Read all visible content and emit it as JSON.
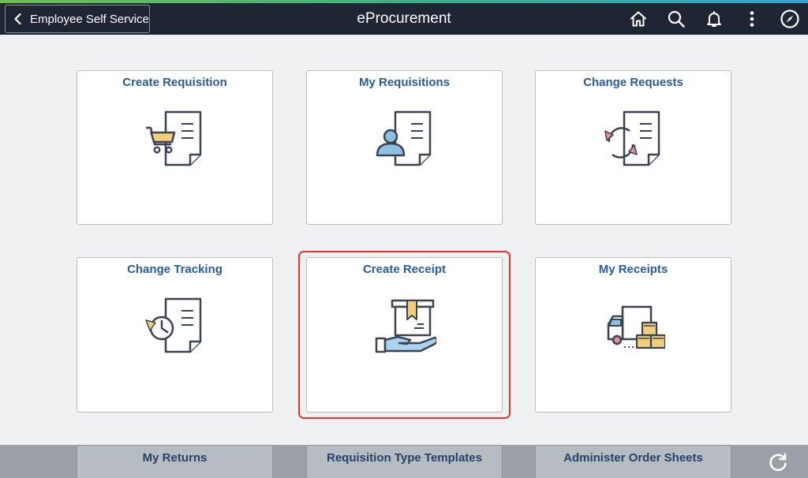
{
  "header": {
    "back_label": "Employee Self Service",
    "title": "eProcurement",
    "icons": [
      "home-icon",
      "search-icon",
      "bell-icon",
      "more-vertical-icon",
      "navbar-compass-icon"
    ]
  },
  "tiles": [
    {
      "label": "Create Requisition",
      "icon": "cart-document-icon"
    },
    {
      "label": "My Requisitions",
      "icon": "person-document-icon"
    },
    {
      "label": "Change Requests",
      "icon": "cycle-document-icon"
    },
    {
      "label": "Change Tracking",
      "icon": "clock-document-icon"
    },
    {
      "label": "Create Receipt",
      "icon": "box-hand-icon",
      "selected": true
    },
    {
      "label": "My Receipts",
      "icon": "truck-boxes-icon"
    }
  ],
  "bottom_tiles": [
    {
      "label": "My Returns"
    },
    {
      "label": "Requisition Type Templates"
    },
    {
      "label": "Administer Order Sheets"
    }
  ],
  "colors": {
    "banner": "#1f2633",
    "tile_title": "#2b5a96",
    "selection_outline": "#e5352b",
    "background": "#eff0f2"
  }
}
